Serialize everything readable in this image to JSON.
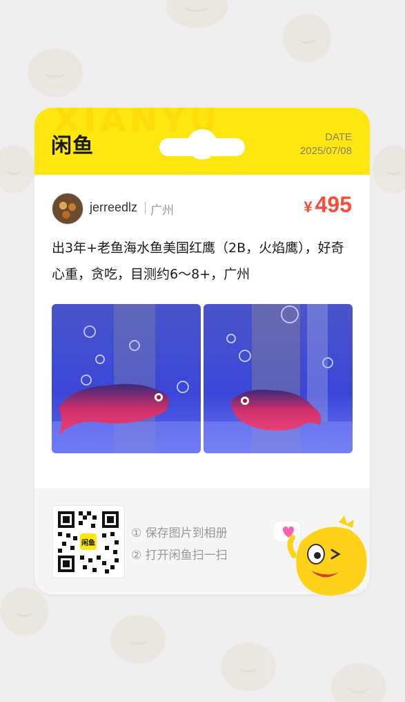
{
  "header": {
    "watermark": "XIANYU",
    "logo": "闲鱼",
    "date_label": "DATE",
    "date_value": "2025/07/08"
  },
  "listing": {
    "username": "jerreedlz",
    "location": "广州",
    "price_symbol": "¥",
    "price": "495",
    "description": "出3年+老鱼海水鱼美国红鹰（2B，火焰鹰），好奇心重，贪吃，目测约6～8+，广州"
  },
  "footer": {
    "step1": "① 保存图片到相册",
    "step2": "② 打开闲鱼扫一扫",
    "qr_badge": "闲鱼"
  },
  "colors": {
    "brand_yellow": "#ffe60f",
    "price_red": "#ff4b3a"
  }
}
